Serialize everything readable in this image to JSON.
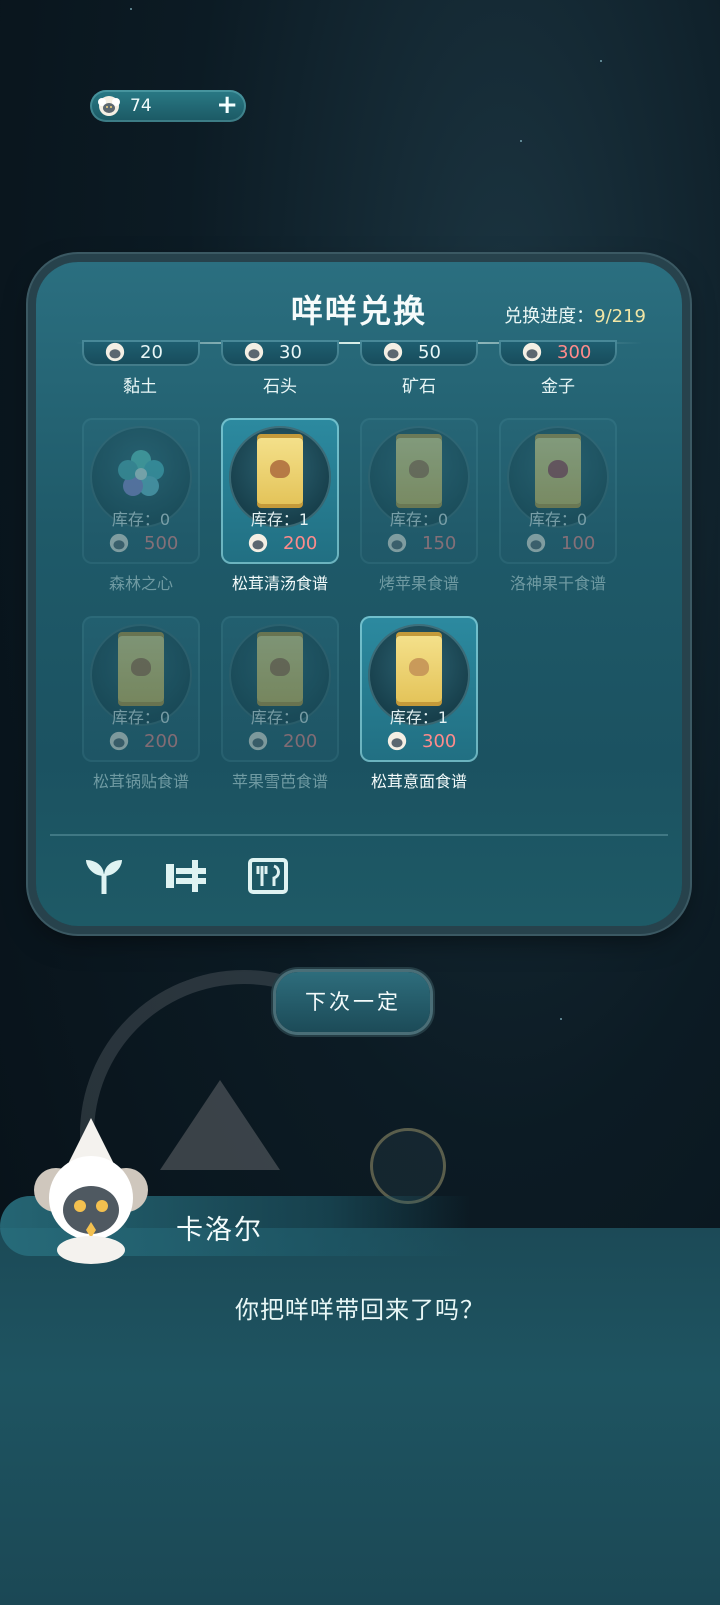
{
  "currency": {
    "amount": "74",
    "add_icon": "plus-icon"
  },
  "panel": {
    "title": "咩咩兑换",
    "progress_label": "兑换进度：",
    "progress_value": "9/219"
  },
  "price_row": [
    {
      "price": "20",
      "name": "黏土"
    },
    {
      "price": "30",
      "name": "石头"
    },
    {
      "price": "50",
      "name": "矿石"
    },
    {
      "price": "300",
      "name": "金子"
    }
  ],
  "items": [
    {
      "name": "森林之心",
      "stock": "库存：0",
      "cost": "500",
      "available": false,
      "icon": "flower-icon"
    },
    {
      "name": "松茸清汤食谱",
      "stock": "库存：1",
      "cost": "200",
      "available": true,
      "icon": "recipe-scroll-icon"
    },
    {
      "name": "烤苹果食谱",
      "stock": "库存：0",
      "cost": "150",
      "available": false,
      "icon": "recipe-scroll-icon"
    },
    {
      "name": "洛神果干食谱",
      "stock": "库存：0",
      "cost": "100",
      "available": false,
      "icon": "recipe-scroll-icon"
    },
    {
      "name": "松茸锅贴食谱",
      "stock": "库存：0",
      "cost": "200",
      "available": false,
      "icon": "recipe-scroll-icon"
    },
    {
      "name": "苹果雪芭食谱",
      "stock": "库存：0",
      "cost": "200",
      "available": false,
      "icon": "recipe-scroll-icon"
    },
    {
      "name": "松茸意面食谱",
      "stock": "库存：1",
      "cost": "300",
      "available": true,
      "icon": "recipe-scroll-icon"
    }
  ],
  "tabs": [
    "sprout-icon",
    "bench-icon",
    "recipe-icon"
  ],
  "next_button": "下次一定",
  "dialog": {
    "speaker": "卡洛尔",
    "text": "你把咩咩带回来了吗？"
  },
  "colors": {
    "price_red": "#ff8b8b",
    "panel": "#1f5a69",
    "progress_value": "#f1e6a6"
  }
}
